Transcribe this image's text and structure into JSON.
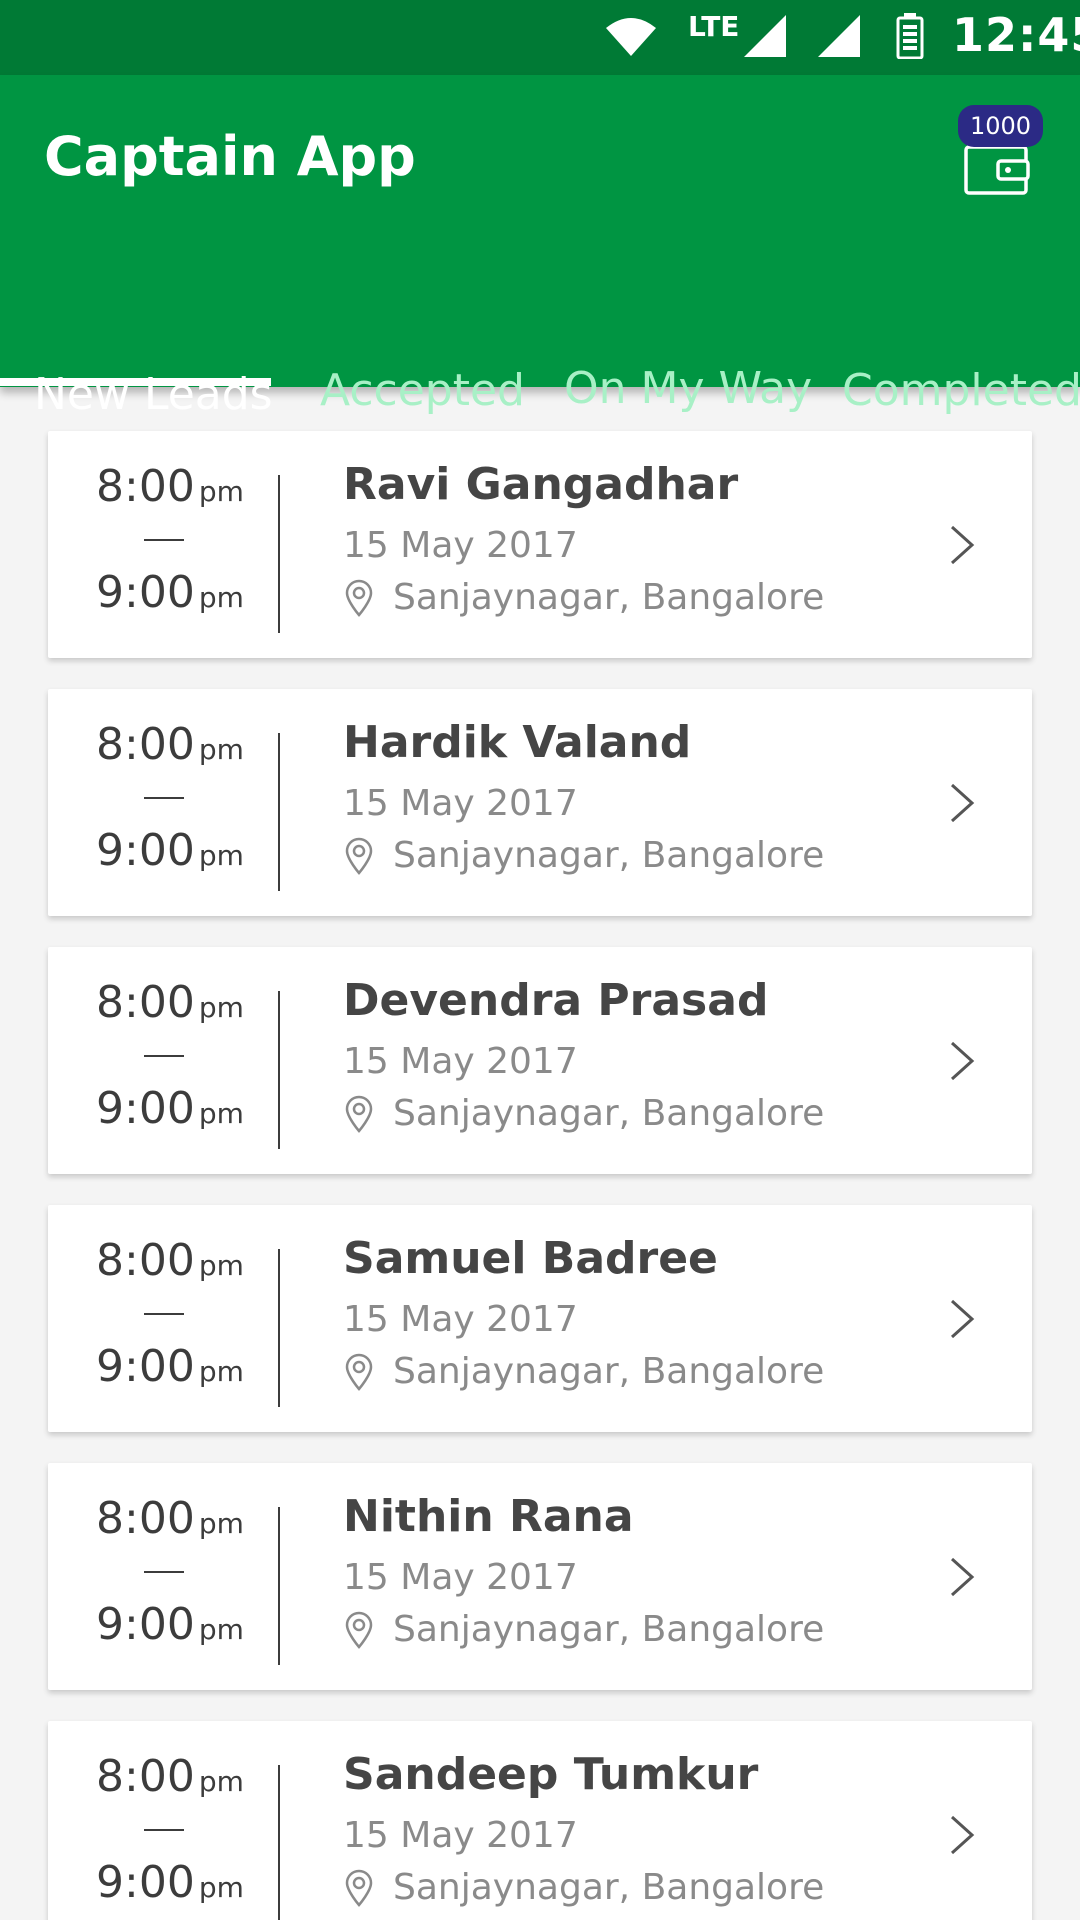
{
  "status_bar": {
    "network": "LTE",
    "time": "12:45"
  },
  "app": {
    "title": "Captain App",
    "wallet_badge": "1000"
  },
  "tabs": [
    {
      "label": "New Leads",
      "active": true
    },
    {
      "label": "Accepted",
      "active": false
    },
    {
      "label": "On My Way",
      "active": false
    },
    {
      "label": "Completed",
      "active": false
    }
  ],
  "leads": [
    {
      "start_time": "8:00",
      "start_ampm": "pm",
      "end_time": "9:00",
      "end_ampm": "pm",
      "name": "Ravi Gangadhar",
      "date": "15 May 2017",
      "location": "Sanjaynagar, Bangalore"
    },
    {
      "start_time": "8:00",
      "start_ampm": "pm",
      "end_time": "9:00",
      "end_ampm": "pm",
      "name": "Hardik Valand",
      "date": "15 May 2017",
      "location": "Sanjaynagar, Bangalore"
    },
    {
      "start_time": "8:00",
      "start_ampm": "pm",
      "end_time": "9:00",
      "end_ampm": "pm",
      "name": "Devendra Prasad",
      "date": "15 May 2017",
      "location": "Sanjaynagar, Bangalore"
    },
    {
      "start_time": "8:00",
      "start_ampm": "pm",
      "end_time": "9:00",
      "end_ampm": "pm",
      "name": "Samuel Badree",
      "date": "15 May 2017",
      "location": "Sanjaynagar, Bangalore"
    },
    {
      "start_time": "8:00",
      "start_ampm": "pm",
      "end_time": "9:00",
      "end_ampm": "pm",
      "name": "Nithin Rana",
      "date": "15 May 2017",
      "location": "Sanjaynagar, Bangalore"
    },
    {
      "start_time": "8:00",
      "start_ampm": "pm",
      "end_time": "9:00",
      "end_ampm": "pm",
      "name": "Sandeep Tumkur",
      "date": "15 May 2017",
      "location": "Sanjaynagar, Bangalore"
    }
  ],
  "colors": {
    "status_bar": "#007a35",
    "app_bar": "#009542",
    "inactive_tab": "#a8f0c6",
    "badge": "#2b2a85"
  },
  "icons": {
    "status": [
      "wifi-icon",
      "signal-icon",
      "battery-icon"
    ],
    "wallet": "wallet-icon",
    "card": [
      "location-pin-icon",
      "chevron-right-icon"
    ]
  }
}
